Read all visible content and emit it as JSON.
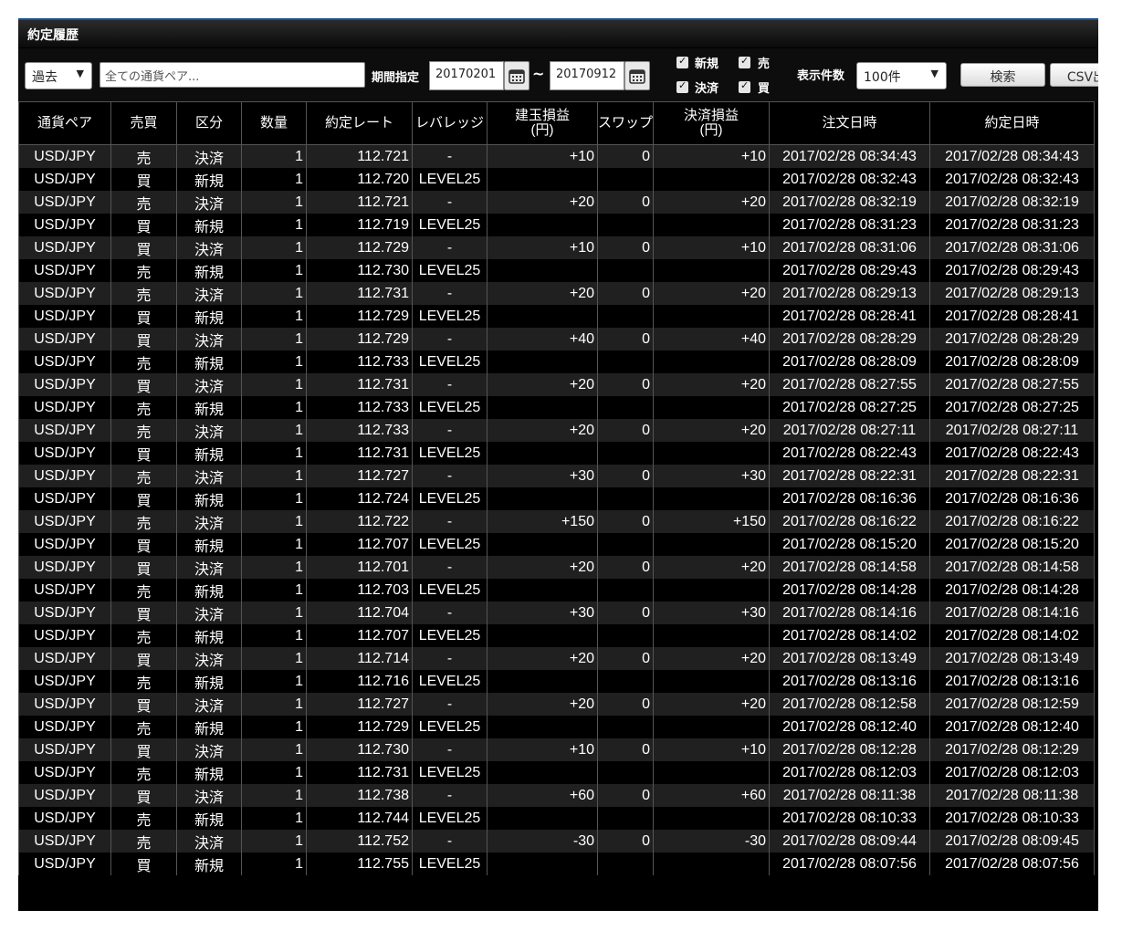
{
  "panel": {
    "title": "約定履歴"
  },
  "toolbar": {
    "period_type": "過去",
    "pair_filter": "全ての通貨ペア...",
    "period_label": "期間指定",
    "date_from": "20170201",
    "date_to": "20170912",
    "tilde": "~",
    "chk_new": "新規",
    "chk_sell": "売",
    "chk_settle": "決済",
    "chk_buy": "買",
    "count_label": "表示件数",
    "count_value": "100件",
    "search_label": "検索",
    "csv_label": "CSV出"
  },
  "columns": [
    "通貨ペア",
    "売買",
    "区分",
    "数量",
    "約定レート",
    "レバレッジ",
    "建玉損益\n(円)",
    "スワップ",
    "決済損益\n(円)",
    "注文日時",
    "約定日時"
  ],
  "rows": [
    [
      "USD/JPY",
      "売",
      "決済",
      "1",
      "112.721",
      "-",
      "+10",
      "0",
      "+10",
      "2017/02/28 08:34:43",
      "2017/02/28 08:34:43"
    ],
    [
      "USD/JPY",
      "買",
      "新規",
      "1",
      "112.720",
      "LEVEL25",
      "",
      "",
      "",
      "2017/02/28 08:32:43",
      "2017/02/28 08:32:43"
    ],
    [
      "USD/JPY",
      "売",
      "決済",
      "1",
      "112.721",
      "-",
      "+20",
      "0",
      "+20",
      "2017/02/28 08:32:19",
      "2017/02/28 08:32:19"
    ],
    [
      "USD/JPY",
      "買",
      "新規",
      "1",
      "112.719",
      "LEVEL25",
      "",
      "",
      "",
      "2017/02/28 08:31:23",
      "2017/02/28 08:31:23"
    ],
    [
      "USD/JPY",
      "買",
      "決済",
      "1",
      "112.729",
      "-",
      "+10",
      "0",
      "+10",
      "2017/02/28 08:31:06",
      "2017/02/28 08:31:06"
    ],
    [
      "USD/JPY",
      "売",
      "新規",
      "1",
      "112.730",
      "LEVEL25",
      "",
      "",
      "",
      "2017/02/28 08:29:43",
      "2017/02/28 08:29:43"
    ],
    [
      "USD/JPY",
      "売",
      "決済",
      "1",
      "112.731",
      "-",
      "+20",
      "0",
      "+20",
      "2017/02/28 08:29:13",
      "2017/02/28 08:29:13"
    ],
    [
      "USD/JPY",
      "買",
      "新規",
      "1",
      "112.729",
      "LEVEL25",
      "",
      "",
      "",
      "2017/02/28 08:28:41",
      "2017/02/28 08:28:41"
    ],
    [
      "USD/JPY",
      "買",
      "決済",
      "1",
      "112.729",
      "-",
      "+40",
      "0",
      "+40",
      "2017/02/28 08:28:29",
      "2017/02/28 08:28:29"
    ],
    [
      "USD/JPY",
      "売",
      "新規",
      "1",
      "112.733",
      "LEVEL25",
      "",
      "",
      "",
      "2017/02/28 08:28:09",
      "2017/02/28 08:28:09"
    ],
    [
      "USD/JPY",
      "買",
      "決済",
      "1",
      "112.731",
      "-",
      "+20",
      "0",
      "+20",
      "2017/02/28 08:27:55",
      "2017/02/28 08:27:55"
    ],
    [
      "USD/JPY",
      "売",
      "新規",
      "1",
      "112.733",
      "LEVEL25",
      "",
      "",
      "",
      "2017/02/28 08:27:25",
      "2017/02/28 08:27:25"
    ],
    [
      "USD/JPY",
      "売",
      "決済",
      "1",
      "112.733",
      "-",
      "+20",
      "0",
      "+20",
      "2017/02/28 08:27:11",
      "2017/02/28 08:27:11"
    ],
    [
      "USD/JPY",
      "買",
      "新規",
      "1",
      "112.731",
      "LEVEL25",
      "",
      "",
      "",
      "2017/02/28 08:22:43",
      "2017/02/28 08:22:43"
    ],
    [
      "USD/JPY",
      "売",
      "決済",
      "1",
      "112.727",
      "-",
      "+30",
      "0",
      "+30",
      "2017/02/28 08:22:31",
      "2017/02/28 08:22:31"
    ],
    [
      "USD/JPY",
      "買",
      "新規",
      "1",
      "112.724",
      "LEVEL25",
      "",
      "",
      "",
      "2017/02/28 08:16:36",
      "2017/02/28 08:16:36"
    ],
    [
      "USD/JPY",
      "売",
      "決済",
      "1",
      "112.722",
      "-",
      "+150",
      "0",
      "+150",
      "2017/02/28 08:16:22",
      "2017/02/28 08:16:22"
    ],
    [
      "USD/JPY",
      "買",
      "新規",
      "1",
      "112.707",
      "LEVEL25",
      "",
      "",
      "",
      "2017/02/28 08:15:20",
      "2017/02/28 08:15:20"
    ],
    [
      "USD/JPY",
      "買",
      "決済",
      "1",
      "112.701",
      "-",
      "+20",
      "0",
      "+20",
      "2017/02/28 08:14:58",
      "2017/02/28 08:14:58"
    ],
    [
      "USD/JPY",
      "売",
      "新規",
      "1",
      "112.703",
      "LEVEL25",
      "",
      "",
      "",
      "2017/02/28 08:14:28",
      "2017/02/28 08:14:28"
    ],
    [
      "USD/JPY",
      "買",
      "決済",
      "1",
      "112.704",
      "-",
      "+30",
      "0",
      "+30",
      "2017/02/28 08:14:16",
      "2017/02/28 08:14:16"
    ],
    [
      "USD/JPY",
      "売",
      "新規",
      "1",
      "112.707",
      "LEVEL25",
      "",
      "",
      "",
      "2017/02/28 08:14:02",
      "2017/02/28 08:14:02"
    ],
    [
      "USD/JPY",
      "買",
      "決済",
      "1",
      "112.714",
      "-",
      "+20",
      "0",
      "+20",
      "2017/02/28 08:13:49",
      "2017/02/28 08:13:49"
    ],
    [
      "USD/JPY",
      "売",
      "新規",
      "1",
      "112.716",
      "LEVEL25",
      "",
      "",
      "",
      "2017/02/28 08:13:16",
      "2017/02/28 08:13:16"
    ],
    [
      "USD/JPY",
      "買",
      "決済",
      "1",
      "112.727",
      "-",
      "+20",
      "0",
      "+20",
      "2017/02/28 08:12:58",
      "2017/02/28 08:12:59"
    ],
    [
      "USD/JPY",
      "売",
      "新規",
      "1",
      "112.729",
      "LEVEL25",
      "",
      "",
      "",
      "2017/02/28 08:12:40",
      "2017/02/28 08:12:40"
    ],
    [
      "USD/JPY",
      "買",
      "決済",
      "1",
      "112.730",
      "-",
      "+10",
      "0",
      "+10",
      "2017/02/28 08:12:28",
      "2017/02/28 08:12:29"
    ],
    [
      "USD/JPY",
      "売",
      "新規",
      "1",
      "112.731",
      "LEVEL25",
      "",
      "",
      "",
      "2017/02/28 08:12:03",
      "2017/02/28 08:12:03"
    ],
    [
      "USD/JPY",
      "買",
      "決済",
      "1",
      "112.738",
      "-",
      "+60",
      "0",
      "+60",
      "2017/02/28 08:11:38",
      "2017/02/28 08:11:38"
    ],
    [
      "USD/JPY",
      "売",
      "新規",
      "1",
      "112.744",
      "LEVEL25",
      "",
      "",
      "",
      "2017/02/28 08:10:33",
      "2017/02/28 08:10:33"
    ],
    [
      "USD/JPY",
      "売",
      "決済",
      "1",
      "112.752",
      "-",
      "-30",
      "0",
      "-30",
      "2017/02/28 08:09:44",
      "2017/02/28 08:09:45"
    ],
    [
      "USD/JPY",
      "買",
      "新規",
      "1",
      "112.755",
      "LEVEL25",
      "",
      "",
      "",
      "2017/02/28 08:07:56",
      "2017/02/28 08:07:56"
    ]
  ],
  "colors": {
    "sell": "#4b8dff",
    "buy": "#ff2424",
    "negative": "#ff2424",
    "row_odd": "#202020",
    "row_even": "#000000"
  },
  "icons": {
    "calendar": "calendar-icon",
    "dropdown": "chevron-down-icon",
    "checkbox": "checkmark-icon"
  }
}
